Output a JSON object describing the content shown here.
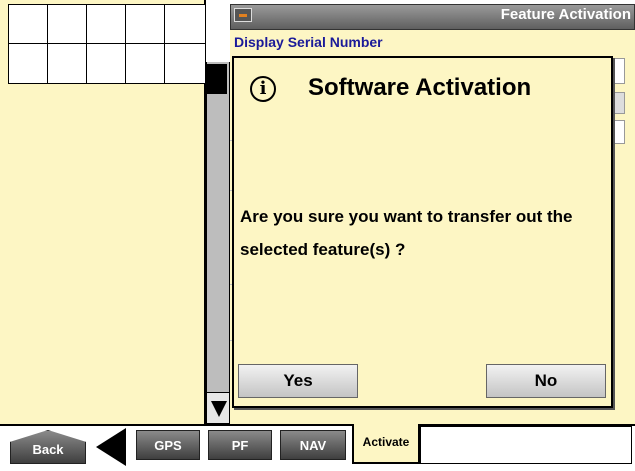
{
  "header": {
    "title": "Feature Activation",
    "icon": "module-icon"
  },
  "panel": {
    "serial_label": "Display Serial Number"
  },
  "dialog": {
    "icon": "info-icon",
    "icon_glyph": "i",
    "title": "Software Activation",
    "message": "Are you sure you want to transfer out the selected feature(s) ?",
    "yes_label": "Yes",
    "no_label": "No"
  },
  "toolbar": {
    "back_label": "Back",
    "gps_label": "GPS",
    "pf_label": "PF",
    "nav_label": "NAV",
    "activate_label": "Activate"
  },
  "colors": {
    "panel_bg": "#fdf6c4",
    "title_bar": "#7a7a7a",
    "serial_label": "#1a1a99"
  }
}
